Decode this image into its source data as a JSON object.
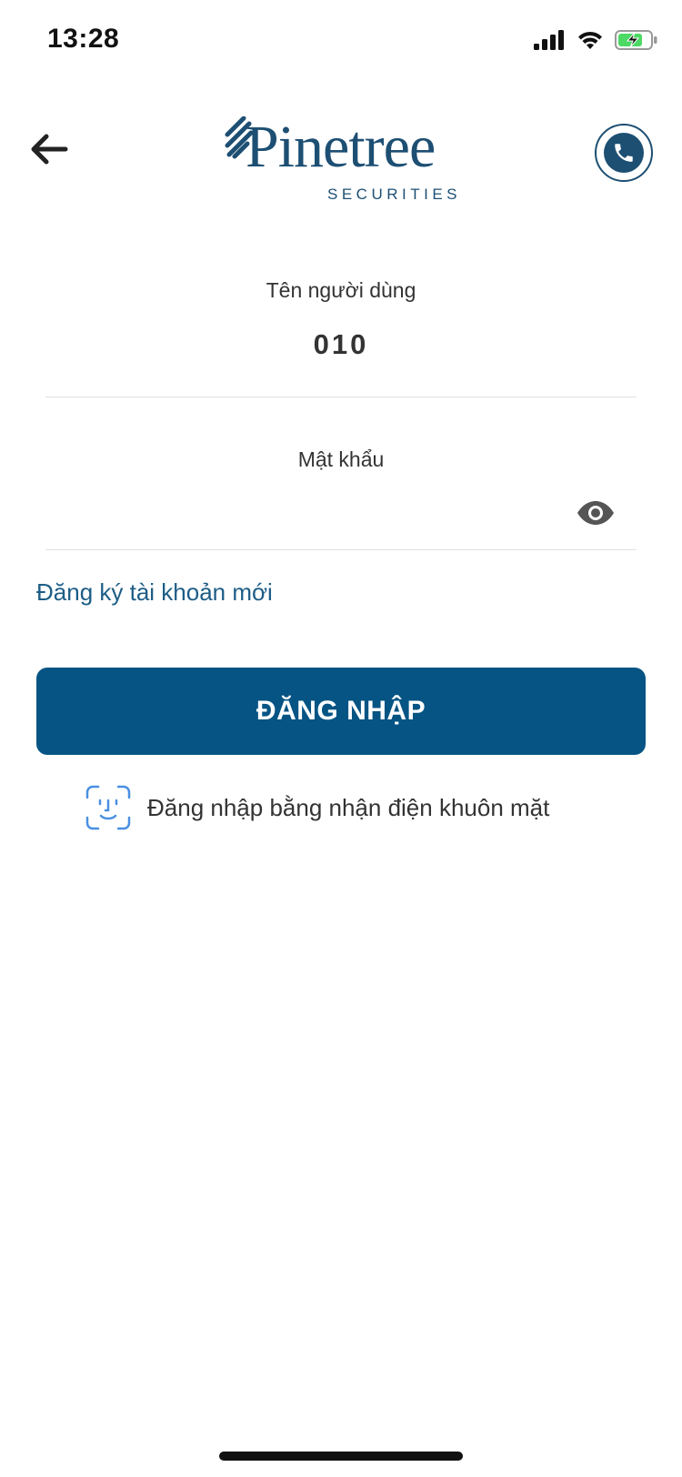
{
  "status_bar": {
    "time": "13:28"
  },
  "header": {
    "logo_word": "Pinetree",
    "logo_subtitle": "SECURITIES",
    "back_icon": "arrow-left-icon",
    "phone_icon": "phone-icon"
  },
  "form": {
    "username_label": "Tên người dùng",
    "username_value": "010",
    "password_label": "Mật khẩu",
    "password_value": "",
    "eye_icon": "eye-icon"
  },
  "links": {
    "register": "Đăng ký tài khoản mới"
  },
  "buttons": {
    "login": "ĐĂNG NHẬP",
    "face_login": "Đăng nhập bằng nhận điện khuôn mặt"
  },
  "colors": {
    "brand": "#1d4f73",
    "primary_button": "#055484",
    "link": "#1d5d86",
    "battery_charging": "#4cd964"
  }
}
